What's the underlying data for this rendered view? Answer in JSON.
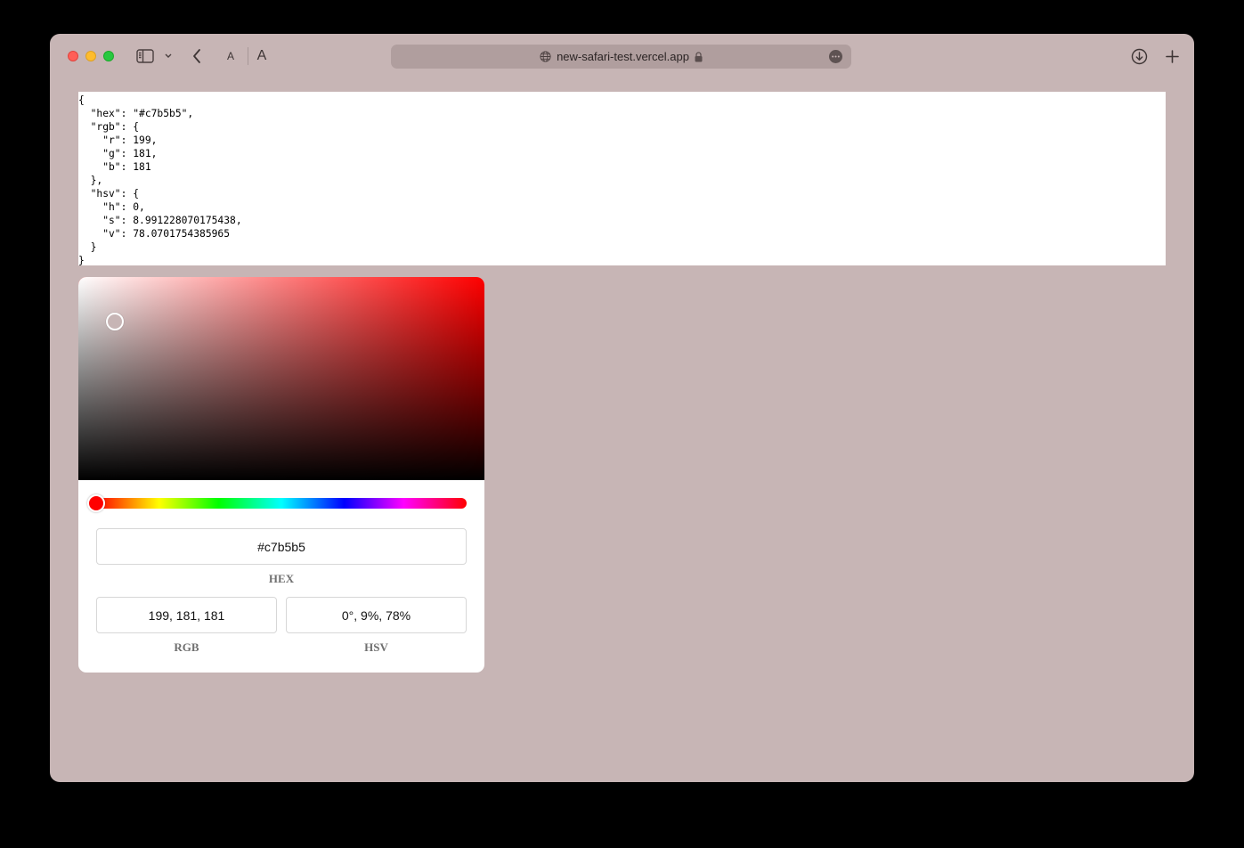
{
  "browser": {
    "url": "new-safari-test.vercel.app",
    "font_small_label": "A",
    "font_large_label": "A",
    "icons": [
      "sidebar-icon",
      "chevron-down-icon",
      "back-arrow-icon",
      "globe-icon",
      "lock-icon",
      "more-icon",
      "download-icon",
      "plus-icon"
    ]
  },
  "page": {
    "background_color": "#c7b5b5",
    "json_output": "{\n  \"hex\": \"#c7b5b5\",\n  \"rgb\": {\n    \"r\": 199,\n    \"g\": 181,\n    \"b\": 181\n  },\n  \"hsv\": {\n    \"h\": 0,\n    \"s\": 8.991228070175438,\n    \"v\": 78.0701754385965\n  }\n}"
  },
  "color_picker": {
    "hex": "#c7b5b5",
    "rgb": "199, 181, 181",
    "hsv": "0°, 9%, 78%",
    "hue_degrees": 0,
    "saturation_percent": 8.991228070175438,
    "value_percent": 78.0701754385965,
    "hex_label": "HEX",
    "rgb_label": "RGB",
    "hsv_label": "HSV"
  }
}
